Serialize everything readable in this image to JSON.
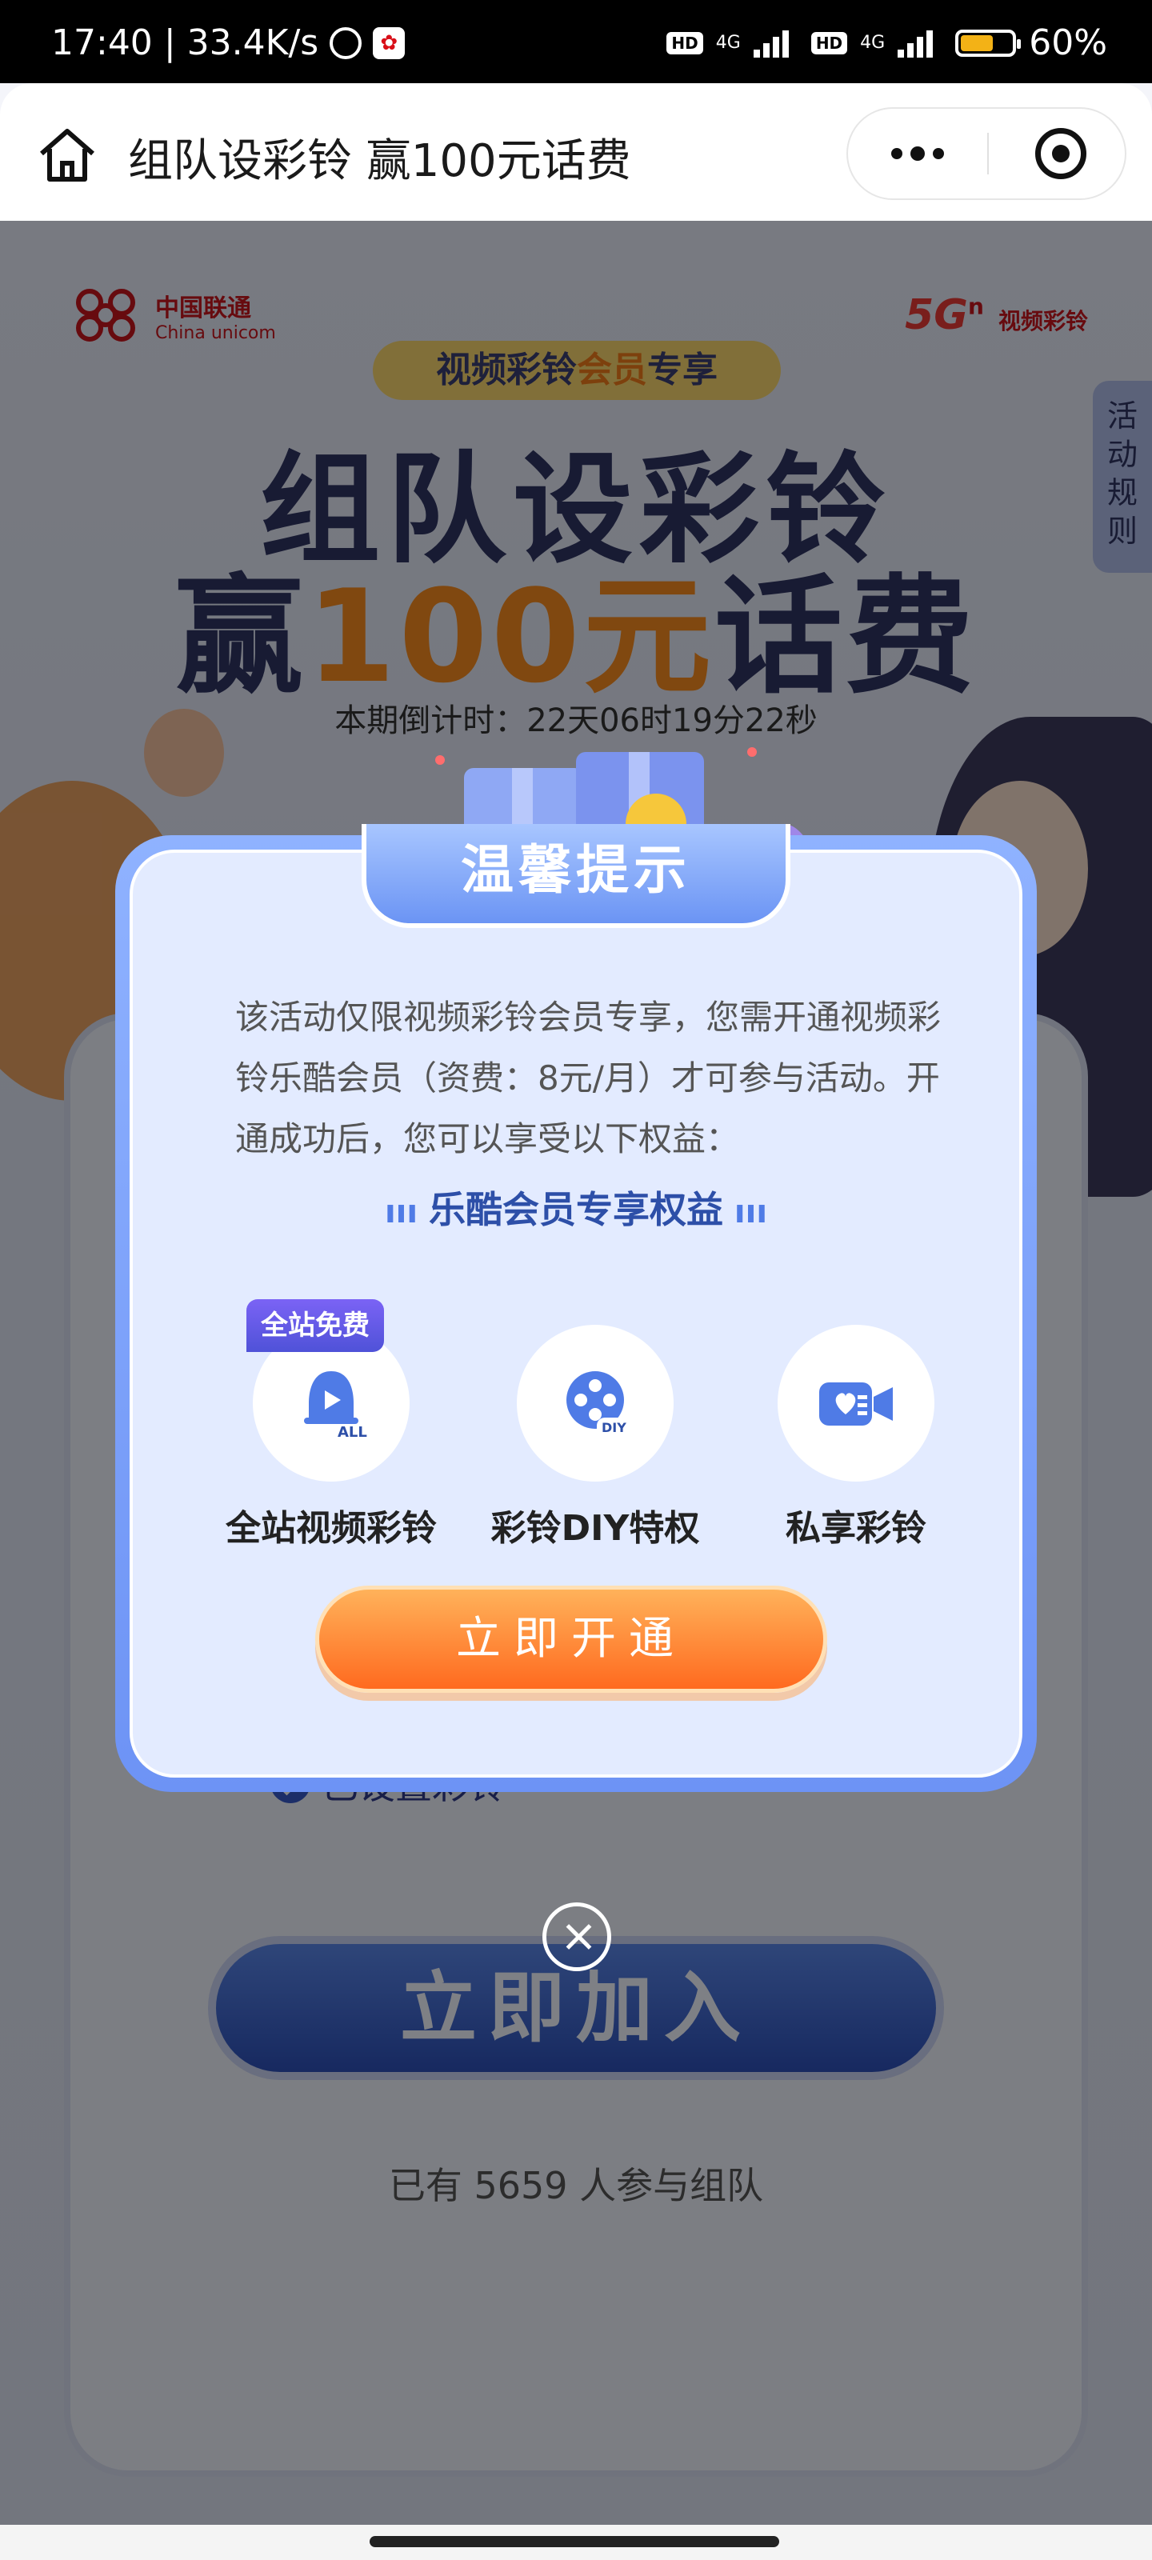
{
  "status_bar": {
    "time": "17:40",
    "net_speed": "33.4K/s",
    "hd1": "HD",
    "hd2": "HD",
    "net1": "4G",
    "net2": "4G",
    "battery": "60%",
    "battery_level": 0.6
  },
  "header": {
    "title": "组队设彩铃 赢100元话费",
    "home_icon": "home-icon",
    "more_icon": "more-icon",
    "close_icon": "target-icon"
  },
  "banner": {
    "brand_cn": "中国联通",
    "brand_en": "China unicom",
    "brand2_main": "5G",
    "brand2_sup": "n",
    "brand2_name": "视频彩铃",
    "member_pill_a": "视频彩铃",
    "member_pill_b": "会员",
    "member_pill_c": "专享",
    "title_line1": "组队设彩铃",
    "title_line2_a": "赢",
    "title_line2_b": "100元",
    "title_line2_c": "话费",
    "countdown": "本期倒计时：22天06时19分22秒",
    "rules_tab": "活动规则"
  },
  "team": {
    "set_status": "已设置彩铃",
    "join_button": "立即加入",
    "participants": "已有 5659 人参与组队"
  },
  "modal": {
    "title": "温馨提示",
    "description": "该活动仅限视频彩铃会员专享，您需开通视频彩铃乐酷会员（资费：8元/月）才可参与活动。开通成功后，您可以享受以下权益：",
    "benefits_heading": "乐酷会员专享权益",
    "benefits": [
      {
        "label": "全站视频彩铃",
        "icon": "bell-play-icon",
        "tag": "全站免费",
        "sub": "ALL"
      },
      {
        "label": "彩铃DIY特权",
        "icon": "film-reel-icon",
        "sub": "DIY"
      },
      {
        "label": "私享彩铃",
        "icon": "heart-video-icon"
      }
    ],
    "open_button": "立即开通",
    "close_icon": "close-icon"
  },
  "colors": {
    "accent_blue": "#6d93f5",
    "button_orange": "#ff7a27",
    "join_blue": "#2c4fb8",
    "brand_red": "#c5161d"
  }
}
